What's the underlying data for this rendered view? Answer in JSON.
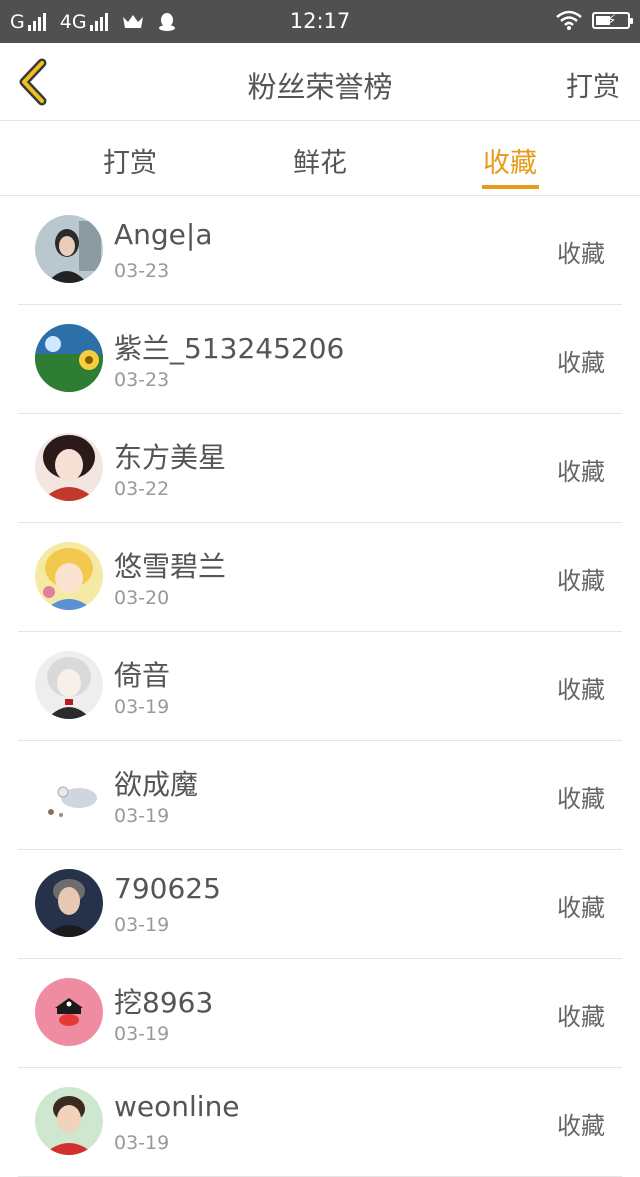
{
  "status_bar": {
    "carrier1": "G",
    "carrier2": "4G",
    "time": "12:17"
  },
  "header": {
    "title": "粉丝荣誉榜",
    "action_label": "打赏",
    "back_icon": "chevron-left-icon",
    "accent_color": "#e89a1a"
  },
  "tabs": [
    {
      "label": "打赏",
      "active": false
    },
    {
      "label": "鲜花",
      "active": false
    },
    {
      "label": "收藏",
      "active": true
    }
  ],
  "fans": [
    {
      "name": "Ange|a",
      "date": "03-23",
      "action": "收藏"
    },
    {
      "name": "紫兰_513245206",
      "date": "03-23",
      "action": "收藏"
    },
    {
      "name": "东方美星",
      "date": "03-22",
      "action": "收藏"
    },
    {
      "name": "悠雪碧兰",
      "date": "03-20",
      "action": "收藏"
    },
    {
      "name": "倚音",
      "date": "03-19",
      "action": "收藏"
    },
    {
      "name": "欲成魔",
      "date": "03-19",
      "action": "收藏"
    },
    {
      "name": "790625",
      "date": "03-19",
      "action": "收藏"
    },
    {
      "name": "挖8963",
      "date": "03-19",
      "action": "收藏"
    },
    {
      "name": "weonline",
      "date": "03-19",
      "action": "收藏"
    }
  ]
}
